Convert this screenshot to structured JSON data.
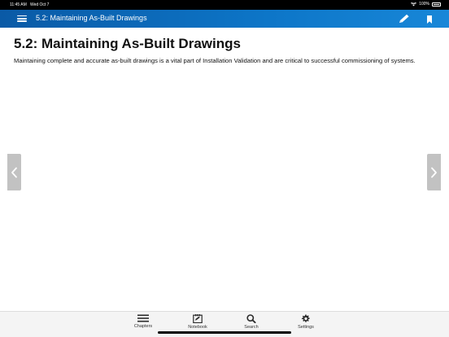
{
  "status_bar": {
    "time": "11:45 AM",
    "date": "Wed Oct 7",
    "battery": "100%"
  },
  "nav_bar": {
    "title": "5.2: Maintaining As-Built Drawings",
    "background_color": "#0d76c8",
    "menu_icon": "hamburger-icon",
    "edit_icon": "pencil-icon",
    "bookmark_icon": "bookmark-icon"
  },
  "content": {
    "heading": "5.2: Maintaining As-Built Drawings",
    "paragraph": "Maintaining complete and accurate as-built drawings is a vital part of Installation Validation and are critical to successful commissioning of systems."
  },
  "side_nav": {
    "prev_icon": "chevron-left-icon",
    "next_icon": "chevron-right-icon"
  },
  "tab_bar": {
    "tabs": [
      {
        "label": "Chapters",
        "icon": "list-icon"
      },
      {
        "label": "Notebook",
        "icon": "notebook-icon"
      },
      {
        "label": "Search",
        "icon": "search-icon"
      },
      {
        "label": "Settings",
        "icon": "gear-icon"
      }
    ]
  }
}
